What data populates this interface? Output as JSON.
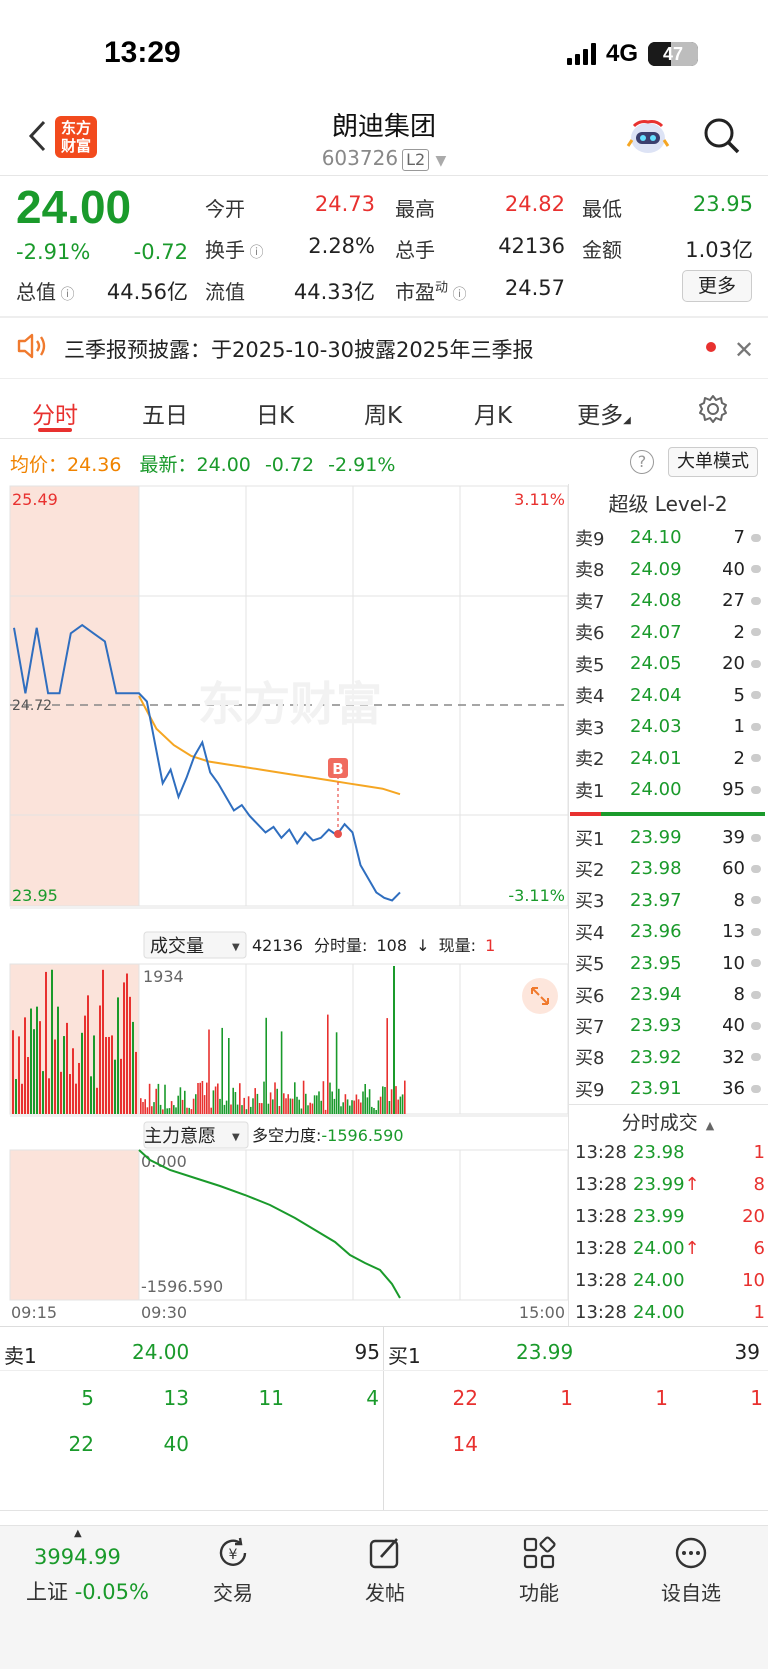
{
  "status": {
    "time": "13:29",
    "network": "4G",
    "battery": "47"
  },
  "header": {
    "title": "朗迪集团",
    "code": "603726",
    "level_badge": "L2",
    "logo_text_line1": "东方",
    "logo_text_line2": "财富"
  },
  "quote": {
    "price": "24.00",
    "change_pct": "-2.91%",
    "change": "-0.72",
    "open_label": "今开",
    "open": "24.73",
    "high_label": "最高",
    "high": "24.82",
    "low_label": "最低",
    "low": "23.95",
    "turnover_label": "换手",
    "turnover": "2.28%",
    "volume_label": "总手",
    "volume": "42136",
    "amount_label": "金额",
    "amount": "1.03亿",
    "mktcap_label": "总值",
    "mktcap": "44.56亿",
    "float_label": "流值",
    "float": "44.33亿",
    "pe_label": "市盈",
    "pe_sup": "动",
    "pe": "24.57",
    "more_label": "更多"
  },
  "notice": {
    "text": "三季报预披露：于2025-10-30披露2025年三季报"
  },
  "tabs": [
    "分时",
    "五日",
    "日K",
    "周K",
    "月K",
    "更多"
  ],
  "avg_row": {
    "avg_label": "均价：",
    "avg": "24.36",
    "latest_label": "最新：",
    "latest": "24.00",
    "chg": "-0.72",
    "pct": "-2.91%",
    "big_mode": "大单模式"
  },
  "chart_data": {
    "type": "line",
    "y_max_label": "25.49",
    "y_min_label": "23.95",
    "pct_max_label": "3.11%",
    "pct_min_label": "-3.11%",
    "prev_close_label": "24.72",
    "watermark": "东方财富",
    "marker_label": "B",
    "x_labels": [
      "09:15",
      "09:30",
      "15:00"
    ],
    "volume_indicator": {
      "name": "成交量",
      "total": "42136",
      "minute_label": "分时量:",
      "minute": "108",
      "arrow": "↓",
      "now_label": "现量:",
      "now": "1",
      "max_label": "1934"
    },
    "force_indicator": {
      "name": "主力意愿",
      "label": "多空力度:",
      "value": "-1596.590",
      "top_label": "0.000",
      "bottom_label": "-1596.590"
    },
    "series": [
      {
        "name": "最新",
        "values": [
          24.97,
          24.73,
          24.97,
          24.73,
          24.73,
          24.95,
          24.98,
          24.95,
          24.92,
          24.73,
          24.73,
          24.73,
          24.7,
          24.55,
          24.4,
          24.45,
          24.35,
          24.42,
          24.5,
          24.55,
          24.44,
          24.4,
          24.35,
          24.3,
          24.32,
          24.28,
          24.25,
          24.22,
          24.24,
          24.2,
          24.23,
          24.18,
          24.22,
          24.19,
          24.2,
          24.23,
          24.21,
          24.25,
          24.22,
          24.1,
          24.05,
          24.0,
          23.98,
          23.97,
          24.0
        ]
      },
      {
        "name": "均价",
        "values": [
          24.72,
          24.6,
          24.54,
          24.5,
          24.48,
          24.47,
          24.46,
          24.45,
          24.44,
          24.43,
          24.42,
          24.41,
          24.4,
          24.39,
          24.38,
          24.36
        ]
      }
    ]
  },
  "orderbook": {
    "title": "超级 Level-2",
    "asks": [
      {
        "label": "卖9",
        "price": "24.10",
        "vol": "7"
      },
      {
        "label": "卖8",
        "price": "24.09",
        "vol": "40"
      },
      {
        "label": "卖7",
        "price": "24.08",
        "vol": "27"
      },
      {
        "label": "卖6",
        "price": "24.07",
        "vol": "2"
      },
      {
        "label": "卖5",
        "price": "24.05",
        "vol": "20"
      },
      {
        "label": "卖4",
        "price": "24.04",
        "vol": "5"
      },
      {
        "label": "卖3",
        "price": "24.03",
        "vol": "1"
      },
      {
        "label": "卖2",
        "price": "24.01",
        "vol": "2"
      },
      {
        "label": "卖1",
        "price": "24.00",
        "vol": "95"
      }
    ],
    "bids": [
      {
        "label": "买1",
        "price": "23.99",
        "vol": "39"
      },
      {
        "label": "买2",
        "price": "23.98",
        "vol": "60"
      },
      {
        "label": "买3",
        "price": "23.97",
        "vol": "8"
      },
      {
        "label": "买4",
        "price": "23.96",
        "vol": "13"
      },
      {
        "label": "买5",
        "price": "23.95",
        "vol": "10"
      },
      {
        "label": "买6",
        "price": "23.94",
        "vol": "8"
      },
      {
        "label": "买7",
        "price": "23.93",
        "vol": "40"
      },
      {
        "label": "买8",
        "price": "23.92",
        "vol": "32"
      },
      {
        "label": "买9",
        "price": "23.91",
        "vol": "36"
      }
    ]
  },
  "trades": {
    "title": "分时成交",
    "rows": [
      {
        "time": "13:28",
        "price": "23.98",
        "arrow": "",
        "vol": "1",
        "color": "green"
      },
      {
        "time": "13:28",
        "price": "23.99",
        "arrow": "↑",
        "vol": "8",
        "color": "green"
      },
      {
        "time": "13:28",
        "price": "23.99",
        "arrow": "",
        "vol": "20",
        "color": "green"
      },
      {
        "time": "13:28",
        "price": "24.00",
        "arrow": "↑",
        "vol": "6",
        "color": "green"
      },
      {
        "time": "13:28",
        "price": "24.00",
        "arrow": "",
        "vol": "10",
        "color": "green"
      },
      {
        "time": "13:28",
        "price": "24.00",
        "arrow": "",
        "vol": "1",
        "color": "green"
      }
    ]
  },
  "queue": {
    "sell_label": "卖1",
    "sell_price": "24.00",
    "sell_vol": "95",
    "buy_label": "买1",
    "buy_price": "23.99",
    "buy_vol": "39",
    "sell_orders": [
      "5",
      "13",
      "11",
      "4",
      "22",
      "40"
    ],
    "buy_orders": [
      "22",
      "1",
      "1",
      "1",
      "14"
    ]
  },
  "nav": {
    "index_value": "3994.99",
    "index_name": "上证",
    "index_pct": "-0.05%",
    "items": [
      "交易",
      "发帖",
      "功能",
      "设自选"
    ]
  }
}
